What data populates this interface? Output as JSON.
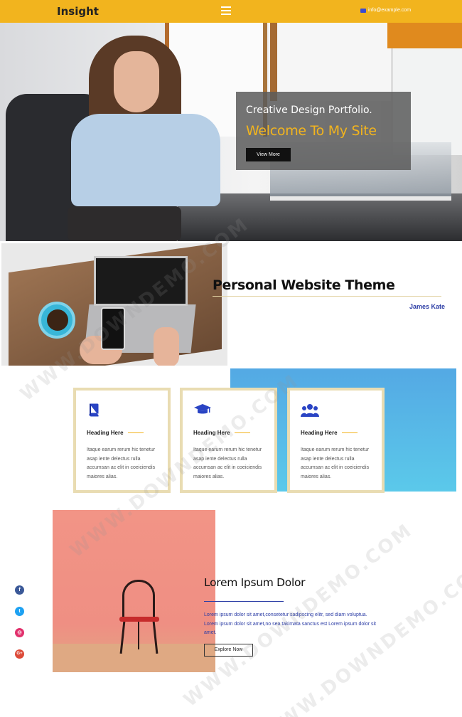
{
  "header": {
    "brand": "Insight",
    "menu_icon": "hamburger-menu-icon",
    "email": "info@example.com",
    "email_icon": "envelope-icon",
    "bg_color": "#f2b41e"
  },
  "hero": {
    "subtitle": "Creative Design Portfolio.",
    "title": "Welcome To My Site",
    "button_label": "View More",
    "accent_color": "#f2b41e"
  },
  "about": {
    "title": "Personal Website Theme",
    "author": "James Kate"
  },
  "features": [
    {
      "icon": "book-icon",
      "heading": "Heading Here",
      "text": "Itaque earum rerum hic tenetur asap iente delectus rulla accumsan ac elit in coeiciendis maiores alias."
    },
    {
      "icon": "graduation-cap-icon",
      "heading": "Heading Here",
      "text": "Itaque earum rerum hic tenetur asap iente delectus rulla accumsan ac elit in coeiciendis maiores alias."
    },
    {
      "icon": "users-icon",
      "heading": "Heading Here",
      "text": "Itaque earum rerum hic tenetur asap iente delectus rulla accumsan ac elit in coeiciendis maiores alias."
    }
  ],
  "lorem": {
    "title": "Lorem Ipsum Dolor",
    "text": "Lorem ipsum dolor sit amet,consetetur sadipscing elitr, sed diam voluptua. Lorem ipsum dolor sit amet,no sea takimata sanctus est Lorem ipsum dolor sit amet.",
    "button_label": "Explore Now"
  },
  "social": [
    {
      "icon": "facebook-icon",
      "glyph": "f",
      "color": "#3b5998"
    },
    {
      "icon": "twitter-icon",
      "glyph": "t",
      "color": "#1da1f2"
    },
    {
      "icon": "instagram-icon",
      "glyph": "◎",
      "color": "#e1306c"
    },
    {
      "icon": "google-plus-icon",
      "glyph": "G+",
      "color": "#dd4b39"
    }
  ],
  "watermark": "WWW.DOWNDEMO.COM"
}
